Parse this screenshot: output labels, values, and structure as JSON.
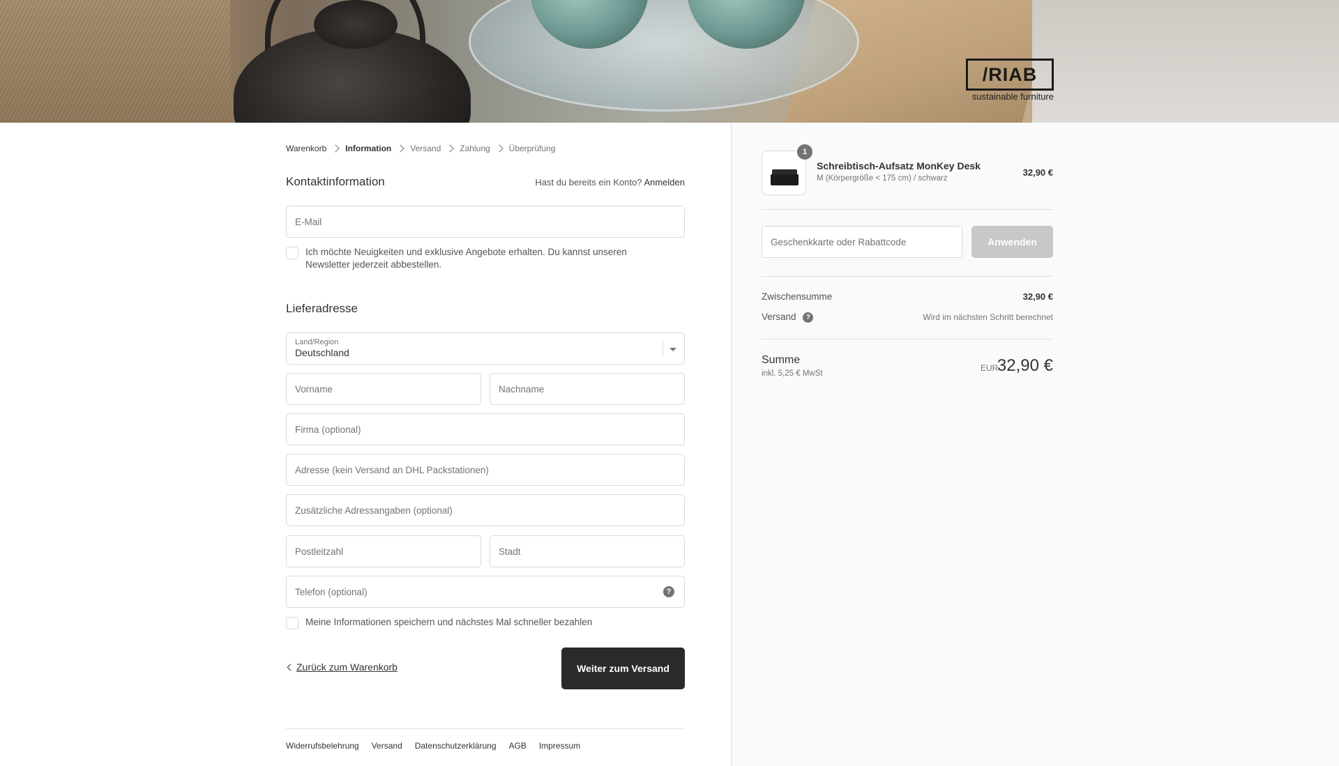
{
  "brand": {
    "logo_text": "/RIAB",
    "tagline": "sustainable furniture"
  },
  "breadcrumb": [
    {
      "label": "Warenkorb"
    },
    {
      "label": "Information"
    },
    {
      "label": "Versand"
    },
    {
      "label": "Zahlung"
    },
    {
      "label": "Überprüfung"
    }
  ],
  "contact": {
    "title": "Kontaktinformation",
    "login_hint": "Hast du bereits ein Konto?",
    "login_link": "Anmelden",
    "email_placeholder": "E-Mail",
    "newsletter_label": "Ich möchte Neuigkeiten und exklusive Angebote erhalten. Du kannst unseren Newsletter jederzeit abbestellen."
  },
  "shipping": {
    "title": "Lieferadresse",
    "country_label": "Land/Region",
    "country_value": "Deutschland",
    "first_name_placeholder": "Vorname",
    "last_name_placeholder": "Nachname",
    "company_placeholder": "Firma (optional)",
    "address_placeholder": "Adresse (kein Versand an DHL Packstationen)",
    "address2_placeholder": "Zusätzliche Adressangaben (optional)",
    "zip_placeholder": "Postleitzahl",
    "city_placeholder": "Stadt",
    "phone_placeholder": "Telefon (optional)",
    "save_info_label": "Meine Informationen speichern und nächstes Mal schneller bezahlen"
  },
  "actions": {
    "back_label": "Zurück zum Warenkorb",
    "continue_label": "Weiter zum Versand"
  },
  "footer_links": [
    "Widerrufsbelehrung",
    "Versand",
    "Datenschutzerklärung",
    "AGB",
    "Impressum"
  ],
  "order": {
    "product": {
      "quantity": "1",
      "name": "Schreibtisch-Aufsatz MonKey Desk",
      "variant": "M (Körpergröße < 175 cm) / schwarz",
      "price": "32,90 €"
    },
    "discount_placeholder": "Geschenkkarte oder Rabattcode",
    "apply_label": "Anwenden",
    "subtotal_label": "Zwischensumme",
    "subtotal_value": "32,90 €",
    "shipping_label": "Versand",
    "shipping_note": "Wird im nächsten Schritt berechnet",
    "total_label": "Summe",
    "tax_note": "inkl. 5,25 € MwSt",
    "currency": "EUR",
    "total_value": "32,90 €"
  }
}
